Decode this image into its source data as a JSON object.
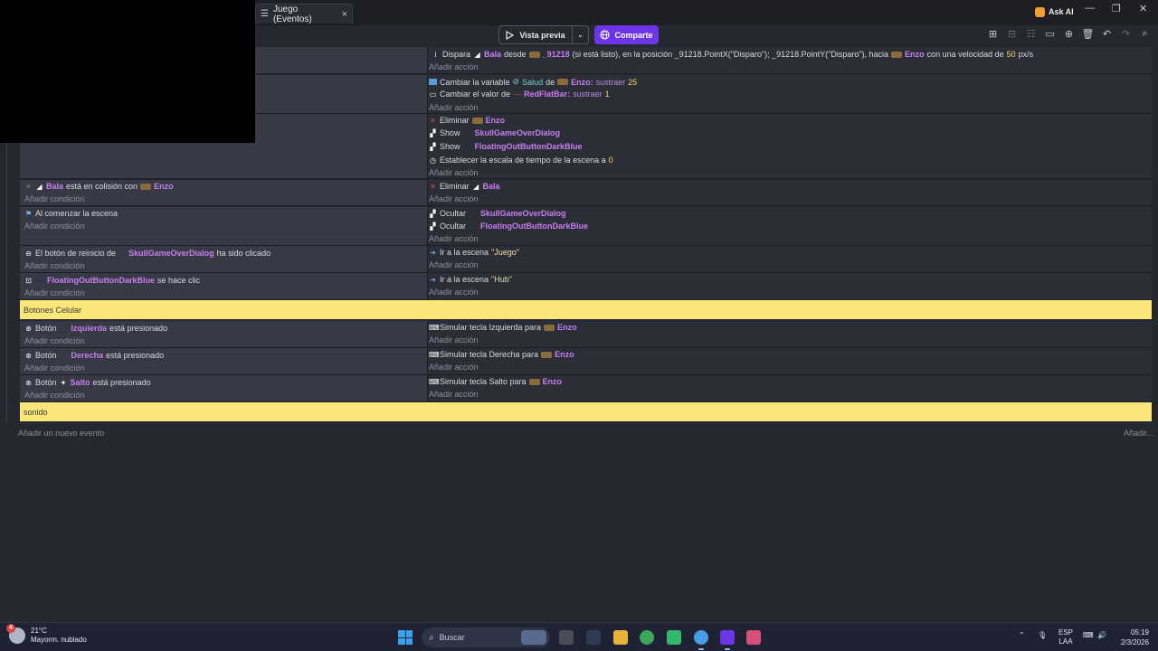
{
  "window": {
    "tab_label": "Juego (Eventos)",
    "tab_close": "×",
    "ask_ai_label": "Ask AI",
    "minimize": "—",
    "maximize": "❐",
    "close": "✕"
  },
  "toolbar": {
    "preview_label": "Vista previa",
    "share_label": "Comparte",
    "accent_color": "#6d35e8"
  },
  "events": [
    {
      "conditions": [],
      "actions": [
        {
          "parts": [
            "Dispara",
            "Bala",
            "desde",
            "_91218",
            "(si está listo), en la posición _91218.PointX(\"Disparo\"); _91218.PointY(\"Disparo\"), hacia",
            "Enzo",
            "con una velocidad de",
            "50",
            "px/s"
          ]
        }
      ],
      "add_action": "Añadir acción"
    },
    {
      "conditions": [],
      "actions": [
        {
          "parts": [
            "Cambiar la variable",
            "Salud",
            "de",
            "Enzo",
            ":",
            "sustraer",
            "25"
          ]
        },
        {
          "parts": [
            "Cambiar el valor de",
            "RedFlatBar",
            ":",
            "sustraer",
            "1"
          ]
        }
      ],
      "add_action": "Añadir acción"
    },
    {
      "conditions": [],
      "actions": [
        {
          "parts": [
            "Eliminar",
            "Enzo"
          ]
        },
        {
          "parts": [
            "Show",
            "SkullGameOverDialog"
          ]
        },
        {
          "parts": [
            "Show",
            "FloatingOutButtonDarkBlue"
          ]
        },
        {
          "parts": [
            "Establecer la escala de tiempo de la escena a",
            "0"
          ]
        }
      ],
      "add_action": "Añadir acción"
    },
    {
      "conditions": [
        {
          "parts": [
            "Bala",
            "está en colisión con",
            "Enzo"
          ]
        }
      ],
      "add_condition": "Añadir condición",
      "actions": [
        {
          "parts": [
            "Eliminar",
            "Bala"
          ]
        }
      ],
      "add_action": "Añadir acción"
    },
    {
      "conditions": [
        {
          "parts": [
            "Al comenzar la escena"
          ]
        }
      ],
      "add_condition": "Añadir condición",
      "actions": [
        {
          "parts": [
            "Ocultar",
            "SkullGameOverDialog"
          ]
        },
        {
          "parts": [
            "Ocultar",
            "FloatingOutButtonDarkBlue"
          ]
        }
      ],
      "add_action": "Añadir acción"
    },
    {
      "conditions": [
        {
          "parts": [
            "El botón de reinicio de",
            "SkullGameOverDialog",
            "ha sido clicado"
          ]
        }
      ],
      "add_condition": "Añadir condición",
      "actions": [
        {
          "parts": [
            "Ir a la escena",
            "\"Juego\""
          ]
        }
      ],
      "add_action": "Añadir acción"
    },
    {
      "conditions": [
        {
          "parts": [
            "FloatingOutButtonDarkBlue",
            "se hace clic"
          ]
        }
      ],
      "add_condition": "Añadir condición",
      "actions": [
        {
          "parts": [
            "Ir a la escena",
            "\"Hub\""
          ]
        }
      ],
      "add_action": "Añadir acción"
    },
    {
      "comment": "Botones Celular"
    },
    {
      "conditions": [
        {
          "parts": [
            "Botón",
            "Izquierda",
            "está presionado"
          ]
        }
      ],
      "add_condition": "Añadir condición",
      "actions": [
        {
          "parts": [
            "Simular tecla Izquierda para",
            "Enzo"
          ]
        }
      ],
      "add_action": "Añadir acción"
    },
    {
      "conditions": [
        {
          "parts": [
            "Botón",
            "Derecha",
            "está presionado"
          ]
        }
      ],
      "add_condition": "Añadir condición",
      "actions": [
        {
          "parts": [
            "Simular tecla Derecha para",
            "Enzo"
          ]
        }
      ],
      "add_action": "Añadir acción"
    },
    {
      "conditions": [
        {
          "parts": [
            "Botón",
            "Salto",
            "está presionado"
          ]
        }
      ],
      "add_condition": "Añadir condición",
      "actions": [
        {
          "parts": [
            "Simular tecla Salto para",
            "Enzo"
          ]
        }
      ],
      "add_action": "Añadir acción"
    },
    {
      "comment": "sonido"
    }
  ],
  "footer": {
    "add_event": "Añadir un nuevo evento",
    "add_more": "Añadir..."
  },
  "taskbar": {
    "weather_badge": "4",
    "temperature": "21°C",
    "weather_desc": "Mayorm. nublado",
    "search_placeholder": "Buscar",
    "lang_top": "ESP",
    "lang_bottom": "LAA",
    "time": "05:19",
    "date": "2/3/2026"
  }
}
